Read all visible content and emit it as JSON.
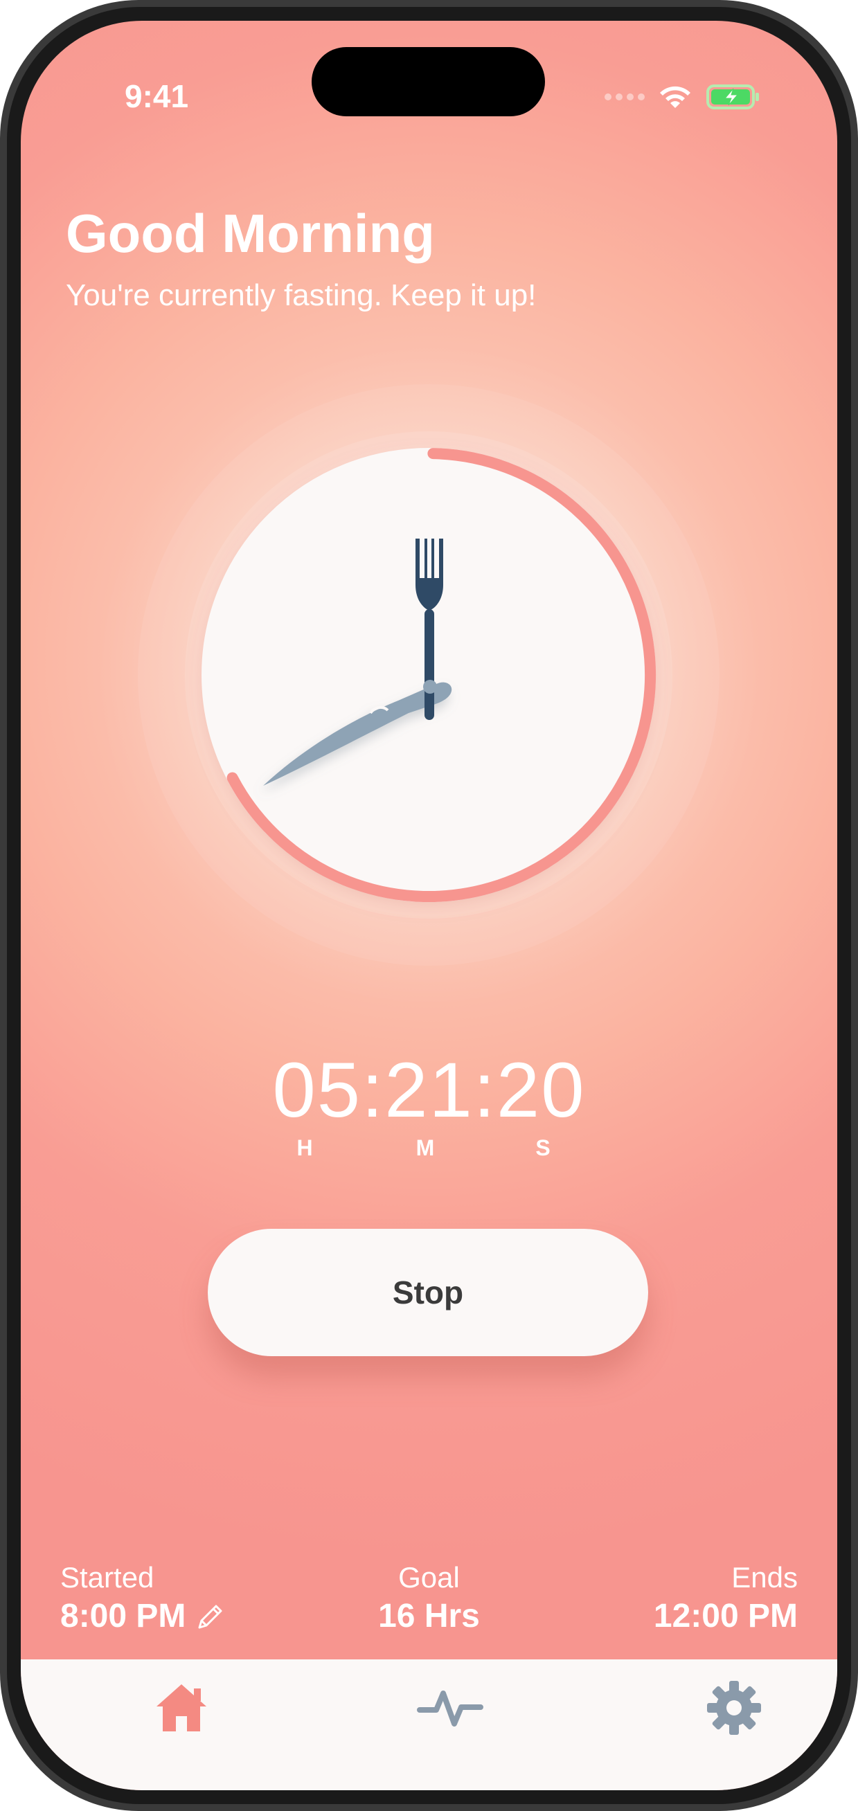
{
  "status_bar": {
    "time": "9:41",
    "icons": [
      "cellular-dots-icon",
      "wifi-icon",
      "battery-charging-icon"
    ]
  },
  "greeting": {
    "title": "Good Morning",
    "subtitle": "You're currently fasting. Keep it up!"
  },
  "timer": {
    "display": "05:21:20",
    "hours_label": "H",
    "minutes_label": "M",
    "seconds_label": "S",
    "progress": 0.67,
    "clock_icons": [
      "fork-icon",
      "knife-icon"
    ]
  },
  "action": {
    "stop_label": "Stop"
  },
  "fast_info": {
    "started_label": "Started",
    "started_value": "8:00 PM",
    "goal_label": "Goal",
    "goal_value": "16 Hrs",
    "ends_label": "Ends",
    "ends_value": "12:00 PM"
  },
  "tab_bar": {
    "items": [
      {
        "icon": "home-icon",
        "active": true
      },
      {
        "icon": "activity-icon",
        "active": false
      },
      {
        "icon": "gear-icon",
        "active": false
      }
    ]
  },
  "colors": {
    "accent": "#f7958f",
    "active_tab": "#f48a82",
    "inactive_tab": "#8a9aaa",
    "clock_face": "#fbf8f7",
    "fork": "#2f4a66",
    "knife": "#8ea3b5"
  }
}
